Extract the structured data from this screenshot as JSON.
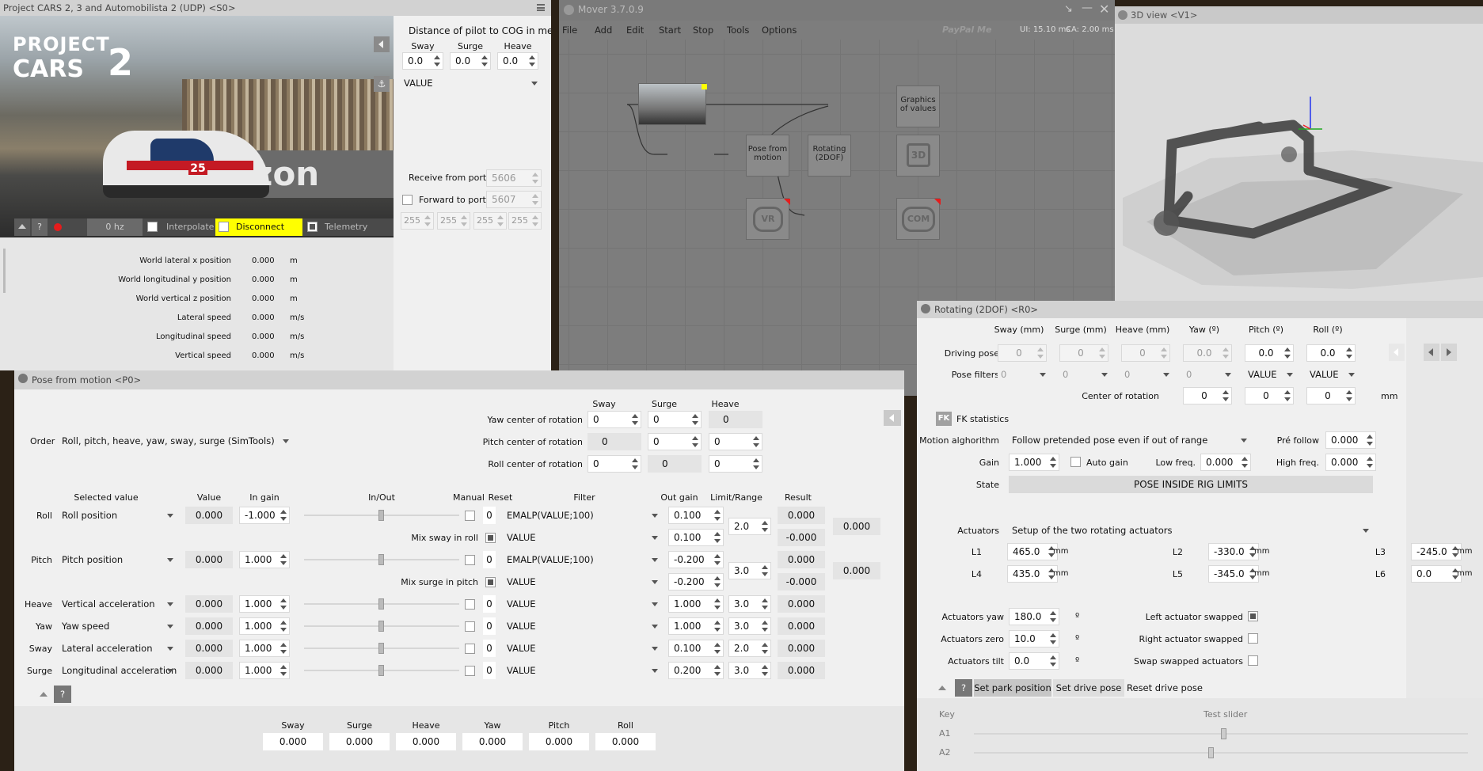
{
  "game_window": {
    "title": "Project CARS 2, 3 and Automobilista 2 (UDP) <S0>",
    "logo_line1": "PROJECT",
    "logo_line2": "CARS",
    "logo_num": "2",
    "car_number": "25",
    "sponsor": "zon",
    "toolbar": {
      "help": "?",
      "rate": "0 hz",
      "interpolate": "Interpolate",
      "disconnect": "Disconnect",
      "telemetry": "Telemetry"
    },
    "cog": {
      "header": "Distance of pilot to COG in meters",
      "labels": [
        "Sway",
        "Surge",
        "Heave"
      ],
      "values": [
        "0.0",
        "0.0",
        "0.0"
      ],
      "select": "VALUE"
    },
    "receive_label": "Receive from port",
    "receive_port": "5606",
    "forward_label": "Forward to port",
    "forward_port": "5607",
    "ip": [
      "255",
      "255",
      "255",
      "255"
    ],
    "telemetry_rows": [
      {
        "label": "World lateral x position",
        "value": "0.000",
        "unit": "m"
      },
      {
        "label": "World longitudinal y position",
        "value": "0.000",
        "unit": "m"
      },
      {
        "label": "World vertical z position",
        "value": "0.000",
        "unit": "m"
      },
      {
        "label": "Lateral speed",
        "value": "0.000",
        "unit": "m/s"
      },
      {
        "label": "Longitudinal speed",
        "value": "0.000",
        "unit": "m/s"
      },
      {
        "label": "Vertical speed",
        "value": "0.000",
        "unit": "m/s"
      }
    ]
  },
  "mover": {
    "title": "Mover 3.7.0.9",
    "menu": [
      "File",
      "Add",
      "Edit",
      "Start",
      "Stop",
      "Tools",
      "Options"
    ],
    "paypal": "PayPal Me",
    "ui_timing": "UI: 15.10 ms",
    "ca_timing": "CA: 2.00 ms",
    "nodes": {
      "pose": "Pose from\nmotion",
      "rotating": "Rotating\n(2DOF)",
      "graphics": "Graphics\nof values",
      "vr": "VR",
      "com": "COM",
      "three_d": "3D"
    }
  },
  "view3d": {
    "title": "3D view <V1>"
  },
  "pose_panel": {
    "title": "Pose from motion <P0>",
    "order_label": "Order",
    "order_value": "Roll, pitch, heave, yaw, sway, surge (SimTools)",
    "center_headers": [
      "Sway",
      "Surge",
      "Heave"
    ],
    "centers": [
      {
        "label": "Yaw center of rotation",
        "values": [
          "0",
          "0",
          "0"
        ]
      },
      {
        "label": "Pitch center of rotation",
        "values": [
          "0",
          "0",
          "0"
        ]
      },
      {
        "label": "Roll center of rotation",
        "values": [
          "0",
          "0",
          "0"
        ]
      }
    ],
    "columns": [
      "Selected value",
      "Value",
      "In gain",
      "In/Out",
      "Manual",
      "Reset",
      "Filter",
      "Out gain",
      "Limit/Range",
      "Result"
    ],
    "rows": [
      {
        "label": "Roll",
        "selected": "Roll position",
        "value": "0.000",
        "in_gain": "-1.000",
        "reset": "0",
        "filter": "EMALP(VALUE;100)",
        "out_gain": "0.100",
        "result": "0.000"
      },
      {
        "label": "",
        "mix": "Mix sway in roll",
        "filter": "VALUE",
        "out_gain": "0.100",
        "result": "-0.000"
      },
      {
        "label": "Pitch",
        "selected": "Pitch position",
        "value": "0.000",
        "in_gain": "1.000",
        "reset": "0",
        "filter": "EMALP(VALUE;100)",
        "out_gain": "-0.200",
        "result": "0.000"
      },
      {
        "label": "",
        "mix": "Mix surge in pitch",
        "filter": "VALUE",
        "out_gain": "-0.200",
        "result": "-0.000"
      },
      {
        "label": "Heave",
        "selected": "Vertical acceleration",
        "value": "0.000",
        "in_gain": "1.000",
        "reset": "0",
        "filter": "VALUE",
        "out_gain": "1.000",
        "limit": "3.0",
        "result": "0.000"
      },
      {
        "label": "Yaw",
        "selected": "Yaw speed",
        "value": "0.000",
        "in_gain": "1.000",
        "reset": "0",
        "filter": "VALUE",
        "out_gain": "1.000",
        "limit": "3.0",
        "result": "0.000"
      },
      {
        "label": "Sway",
        "selected": "Lateral acceleration",
        "value": "0.000",
        "in_gain": "1.000",
        "reset": "0",
        "filter": "VALUE",
        "out_gain": "0.100",
        "limit": "2.0",
        "result": "0.000"
      },
      {
        "label": "Surge",
        "selected": "Longitudinal acceleration",
        "value": "0.000",
        "in_gain": "1.000",
        "reset": "0",
        "filter": "VALUE",
        "out_gain": "0.200",
        "limit": "3.0",
        "result": "0.000"
      }
    ],
    "roll_limit": "2.0",
    "pitch_limit": "3.0",
    "roll_total": "0.000",
    "pitch_total": "0.000",
    "help": "?",
    "outputs": [
      {
        "label": "Sway",
        "value": "0.000"
      },
      {
        "label": "Surge",
        "value": "0.000"
      },
      {
        "label": "Heave",
        "value": "0.000"
      },
      {
        "label": "Yaw",
        "value": "0.000"
      },
      {
        "label": "Pitch",
        "value": "0.000"
      },
      {
        "label": "Roll",
        "value": "0.000"
      }
    ]
  },
  "rotating": {
    "title": "Rotating (2DOF) <R0>",
    "headers": [
      "Sway (mm)",
      "Surge (mm)",
      "Heave (mm)",
      "Yaw (º)",
      "Pitch (º)",
      "Roll (º)"
    ],
    "driving_label": "Driving pose",
    "driving": [
      "0",
      "0",
      "0",
      "0.0",
      "0.0",
      "0.0"
    ],
    "filters_label": "Pose filters",
    "filters": [
      "0",
      "0",
      "0",
      "0",
      "VALUE",
      "VALUE"
    ],
    "cor_label": "Center of rotation",
    "cor": [
      "0",
      "0",
      "0"
    ],
    "cor_unit": "mm",
    "fk": "FK",
    "fk_label": "FK statistics",
    "algo_label": "Motion alghorithm",
    "algo_value": "Follow pretended pose even if out of range",
    "prefollow_label": "Pré follow",
    "prefollow": "0.000",
    "gain_label": "Gain",
    "gain": "1.000",
    "autogain": "Auto gain",
    "lowfreq_label": "Low freq.",
    "lowfreq": "0.000",
    "highfreq_label": "High freq.",
    "highfreq": "0.000",
    "state_label": "State",
    "state": "POSE INSIDE RIG LIMITS",
    "actuators_label": "Actuators",
    "actuators_value": "Setup of the two rotating actuators",
    "lengths": [
      {
        "label": "L1",
        "value": "465.0"
      },
      {
        "label": "L2",
        "value": "-330.0"
      },
      {
        "label": "L3",
        "value": "-245.0"
      },
      {
        "label": "L4",
        "value": "435.0"
      },
      {
        "label": "L5",
        "value": "-345.0"
      },
      {
        "label": "L6",
        "value": "0.0"
      }
    ],
    "mm": "mm",
    "act_yaw_label": "Actuators yaw",
    "act_yaw": "180.0",
    "act_zero_label": "Actuators zero",
    "act_zero": "10.0",
    "act_tilt_label": "Actuators tilt",
    "act_tilt": "0.0",
    "deg": "º",
    "left_swapped": "Left actuator swapped",
    "right_swapped": "Right actuator swapped",
    "swap_swapped": "Swap swapped actuators",
    "help": "?",
    "set_park": "Set park position",
    "set_drive": "Set drive pose",
    "reset_drive": "Reset drive pose",
    "key_label": "Key",
    "test_slider_label": "Test slider",
    "a1": "A1",
    "a2": "A2"
  }
}
